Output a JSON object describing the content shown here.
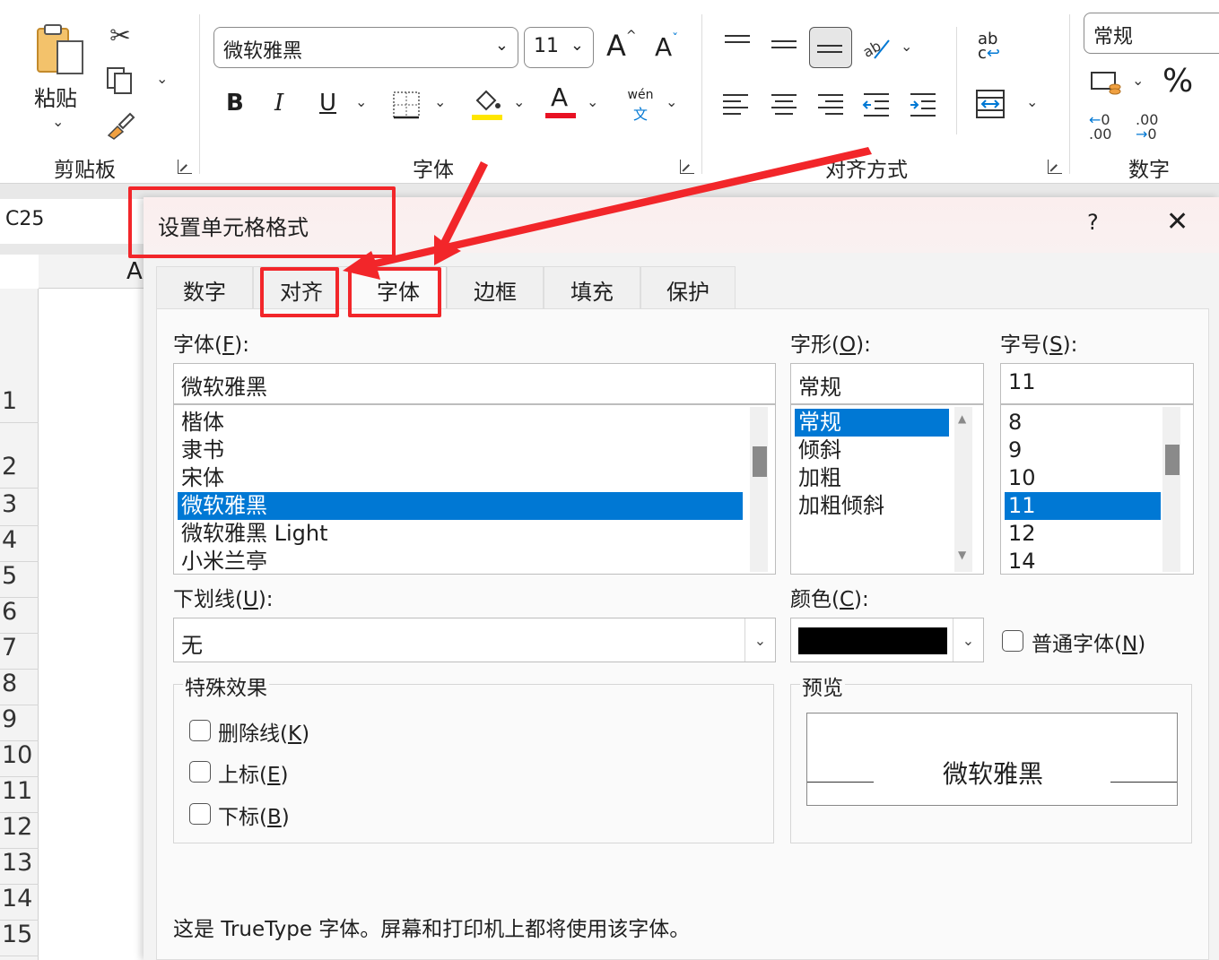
{
  "ribbon": {
    "clipboard": {
      "paste_label": "粘贴",
      "group_label": "剪贴板"
    },
    "font": {
      "font_name": "微软雅黑",
      "font_size": "11",
      "bold": "B",
      "italic": "I",
      "underline": "U",
      "phonetic_top": "wén",
      "phonetic_bottom": "文",
      "grow": "A",
      "shrink": "A",
      "font_color_letter": "A",
      "group_label": "字体"
    },
    "alignment": {
      "group_label": "对齐方式",
      "wrap_top": "ab",
      "wrap_bottom": "c"
    },
    "number": {
      "format": "常规",
      "percent": "%",
      "dec_inc": ".00",
      "dec_dec": ".00",
      "group_label": "数字"
    }
  },
  "sheet": {
    "name_box": "C25",
    "column_header": "A",
    "row_numbers": [
      "1",
      "2",
      "3",
      "4",
      "5",
      "6",
      "7",
      "8",
      "9",
      "10",
      "11",
      "12",
      "13",
      "14",
      "15"
    ]
  },
  "dialog": {
    "title": "设置单元格格式",
    "help": "?",
    "close": "✕",
    "tabs": [
      "数字",
      "对齐",
      "字体",
      "边框",
      "填充",
      "保护"
    ],
    "font_label": "字体(",
    "font_label_key": "F",
    "font_label_end": "):",
    "font_value": "微软雅黑",
    "font_list": [
      "楷体",
      "隶书",
      "宋体",
      "微软雅黑",
      "微软雅黑 Light",
      "小米兰亭"
    ],
    "style_label": "字形(",
    "style_label_key": "O",
    "style_label_end": "):",
    "style_value": "常规",
    "style_list": [
      "常规",
      "倾斜",
      "加粗",
      "加粗倾斜"
    ],
    "size_label": "字号(",
    "size_label_key": "S",
    "size_label_end": "):",
    "size_value": "11",
    "size_list": [
      "8",
      "9",
      "10",
      "11",
      "12",
      "14"
    ],
    "underline_label": "下划线(",
    "underline_label_key": "U",
    "underline_label_end": "):",
    "underline_value": "无",
    "color_label": "颜色(",
    "color_label_key": "C",
    "color_label_end": "):",
    "color_value": "#000000",
    "normal_font_label": "普通字体(",
    "normal_font_key": "N",
    "normal_font_end": ")",
    "effects_label": "特殊效果",
    "strikethrough_label": "删除线(",
    "strikethrough_key": "K",
    "strikethrough_end": ")",
    "superscript_label": "上标(",
    "superscript_key": "E",
    "superscript_end": ")",
    "subscript_label": "下标(",
    "subscript_key": "B",
    "subscript_end": ")",
    "preview_label": "预览",
    "preview_text": "微软雅黑",
    "info_text": "这是 TrueType 字体。屏幕和打印机上都将使用该字体。"
  },
  "colors": {
    "highlight_red": "#f2262a",
    "selection_blue": "#0078d4",
    "font_color_bar": "#e81123",
    "fill_color_bar": "#ffe600"
  }
}
